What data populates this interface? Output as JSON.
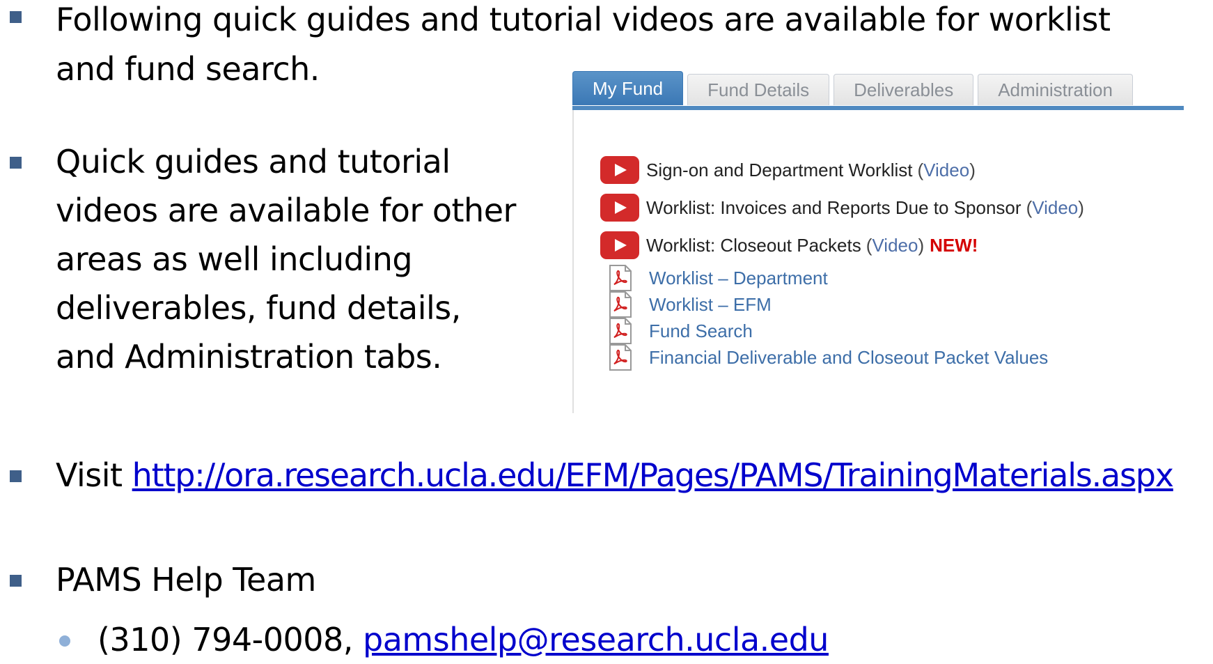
{
  "bullets": {
    "first_line1": "Following quick guides and tutorial videos are available for worklist",
    "first_line2": "and fund search.",
    "second_lines": [
      "Quick guides and tutorial",
      "videos are available for other",
      "areas as well including",
      "deliverables, fund details,",
      "and Administration tabs."
    ],
    "visit_label": "Visit",
    "visit_url": "http://ora.research.ucla.edu/EFM/Pages/PAMS/TrainingMaterials.aspx",
    "help_team": "PAMS Help Team",
    "phone": "(310) 794-0008,",
    "email": "pamshelp@research.ucla.edu"
  },
  "panel": {
    "tabs": [
      "My Fund",
      "Fund Details",
      "Deliverables",
      "Administration"
    ],
    "video_items": [
      {
        "label": "Sign-on and Department Worklist",
        "video": "Video",
        "new": ""
      },
      {
        "label": "Worklist: Invoices and Reports Due to Sponsor",
        "video": "Video",
        "new": ""
      },
      {
        "label": "Worklist: Closeout Packets",
        "video": "Video",
        "new": "NEW!"
      }
    ],
    "pdf_items": [
      "Worklist – Department",
      "Worklist – EFM",
      "Fund Search",
      "Financial Deliverable and Closeout Packet Values"
    ]
  },
  "colors": {
    "bullet": "#3f5f89",
    "accent_tab": "#3b78b5",
    "new_badge": "#d40000",
    "youtube_red": "#d32a2a"
  }
}
